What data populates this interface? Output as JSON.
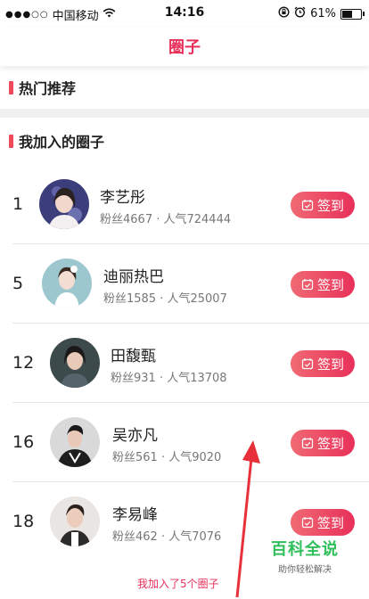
{
  "status_bar": {
    "signal_dots": "●●●○○",
    "carrier": "中国移动",
    "time": "14:16",
    "battery": "61%",
    "battery_level": 0.61
  },
  "header": {
    "title": "圈子"
  },
  "sections": {
    "hot": "热门推荐",
    "joined": "我加入的圈子"
  },
  "circles": [
    {
      "rank": "1",
      "name": "李艺彤",
      "stats": "粉丝4667 · 人气724444",
      "button": "签到",
      "avatar_bg": "#3b3e7a"
    },
    {
      "rank": "5",
      "name": "迪丽热巴",
      "stats": "粉丝1585 · 人气25007",
      "button": "签到",
      "avatar_bg": "#9cc7cf"
    },
    {
      "rank": "12",
      "name": "田馥甄",
      "stats": "粉丝931 · 人气13708",
      "button": "签到",
      "avatar_bg": "#3c4a4c"
    },
    {
      "rank": "16",
      "name": "吴亦凡",
      "stats": "粉丝561 · 人气9020",
      "button": "签到",
      "avatar_bg": "#d9d9d9"
    },
    {
      "rank": "18",
      "name": "李易峰",
      "stats": "粉丝462 · 人气7076",
      "button": "签到",
      "avatar_bg": "#e9e5e2"
    }
  ],
  "footer": {
    "joined_count_text": "我加入了5个圈子"
  },
  "watermark": {
    "main": "百科全说",
    "sub": "助你轻松解决"
  },
  "colors": {
    "accent": "#e8305a",
    "watermark_green": "#2fbf5a"
  }
}
